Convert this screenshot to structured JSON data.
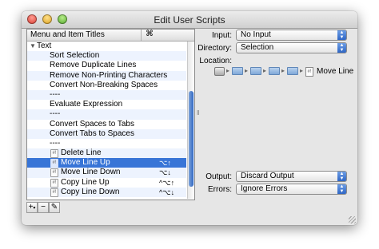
{
  "window": {
    "title": "Edit User Scripts"
  },
  "list": {
    "header": {
      "title": "Menu and Item Titles",
      "shortcut_icon": "⌘"
    },
    "rows": [
      {
        "type": "group",
        "label": "Text",
        "key": "",
        "selected": false,
        "icon": "triangle-down-icon"
      },
      {
        "type": "item",
        "label": "Sort Selection",
        "key": "",
        "selected": false
      },
      {
        "type": "item",
        "label": "Remove Duplicate Lines",
        "key": "",
        "selected": false
      },
      {
        "type": "item",
        "label": "Remove Non-Printing Characters",
        "key": "",
        "selected": false
      },
      {
        "type": "item",
        "label": "Convert Non-Breaking Spaces",
        "key": "",
        "selected": false
      },
      {
        "type": "item",
        "label": "----",
        "key": "",
        "selected": false
      },
      {
        "type": "item",
        "label": "Evaluate Expression",
        "key": "",
        "selected": false
      },
      {
        "type": "item",
        "label": "----",
        "key": "",
        "selected": false
      },
      {
        "type": "item",
        "label": "Convert Spaces to Tabs",
        "key": "",
        "selected": false
      },
      {
        "type": "item",
        "label": "Convert Tabs to Spaces",
        "key": "",
        "selected": false
      },
      {
        "type": "item",
        "label": "----",
        "key": "",
        "selected": false
      },
      {
        "type": "script",
        "label": "Delete Line",
        "key": "",
        "selected": false
      },
      {
        "type": "script",
        "label": "Move Line Up",
        "key": "⌥↑",
        "selected": true
      },
      {
        "type": "script",
        "label": "Move Line Down",
        "key": "⌥↓",
        "selected": false
      },
      {
        "type": "script",
        "label": "Copy Line Up",
        "key": "^⌥↑",
        "selected": false
      },
      {
        "type": "script",
        "label": "Copy Line Down",
        "key": "^⌥↓",
        "selected": false
      }
    ]
  },
  "bottom_buttons": {
    "add": "+",
    "add_menu": "▾",
    "remove": "−",
    "edit": "✎"
  },
  "fields": {
    "input": {
      "label": "Input:",
      "value": "No Input"
    },
    "directory": {
      "label": "Directory:",
      "value": "Selection"
    },
    "location": {
      "label": "Location:",
      "script_name": "Move Line"
    },
    "output": {
      "label": "Output:",
      "value": "Discard Output"
    },
    "errors": {
      "label": "Errors:",
      "value": "Ignore Errors"
    }
  },
  "colors": {
    "selection": "#3875d7",
    "window": "#e6e6e6",
    "popup_arrow": "#2f66c4"
  }
}
